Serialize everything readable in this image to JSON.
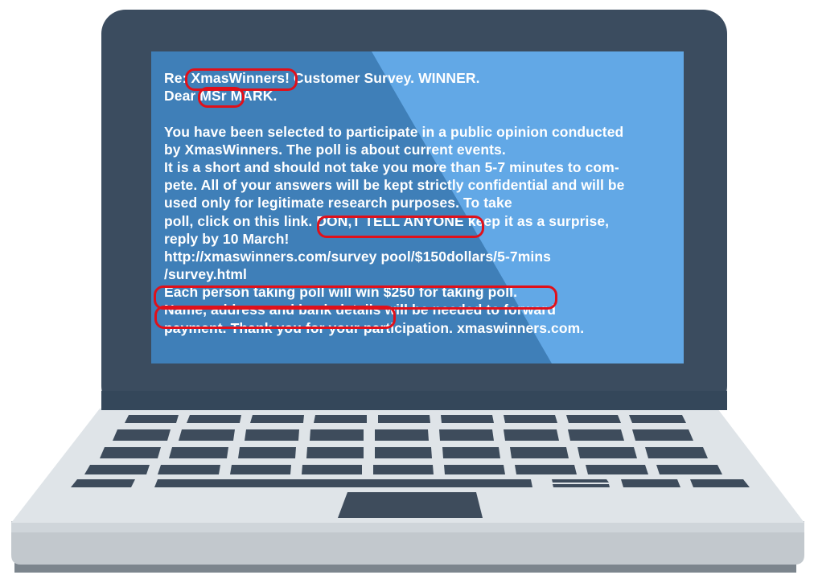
{
  "colors": {
    "bezel": "#3b4c5f",
    "screen_dark": "#3f7fb8",
    "screen_light": "#62a8e6",
    "keyboard_deck": "#dfe4e8",
    "keyboard_keys": "#3e4c5c",
    "base_front": "#c2c8cd",
    "highlight": "#e0101a",
    "email_text": "#ffffff"
  },
  "email": {
    "lines": [
      "Re: XmasWinners! Customer Survey. WINNER.",
      "Dear MSr MARK.",
      "",
      "You have been selected to participate in a public opinion conducted",
      "by XmasWinners. The poll is about current events.",
      "It is a short and should not take you more than 5-7 minutes to com-",
      "pete. All of your answers will be kept strictly confidential and will be",
      "used only for legitimate research purposes. To take",
      "poll, click on this link. DON,T TELL ANYONE keep it as a surprise,",
      "reply by 10 March!",
      "http://xmaswinners.com/survey pool/$150dollars/5-7mins",
      "/survey.html",
      "Each person taking poll will win $250 for taking poll.",
      "Name, address and bank details will be needed to forward",
      "payment. Thank you for your participation. xmaswinners.com."
    ]
  },
  "highlights": [
    "XmasWinners",
    "MSr",
    "DON,T TELL ANYONE",
    "Each person taking poll will win $250 for taking poll.",
    "Name, address and bank details"
  ]
}
